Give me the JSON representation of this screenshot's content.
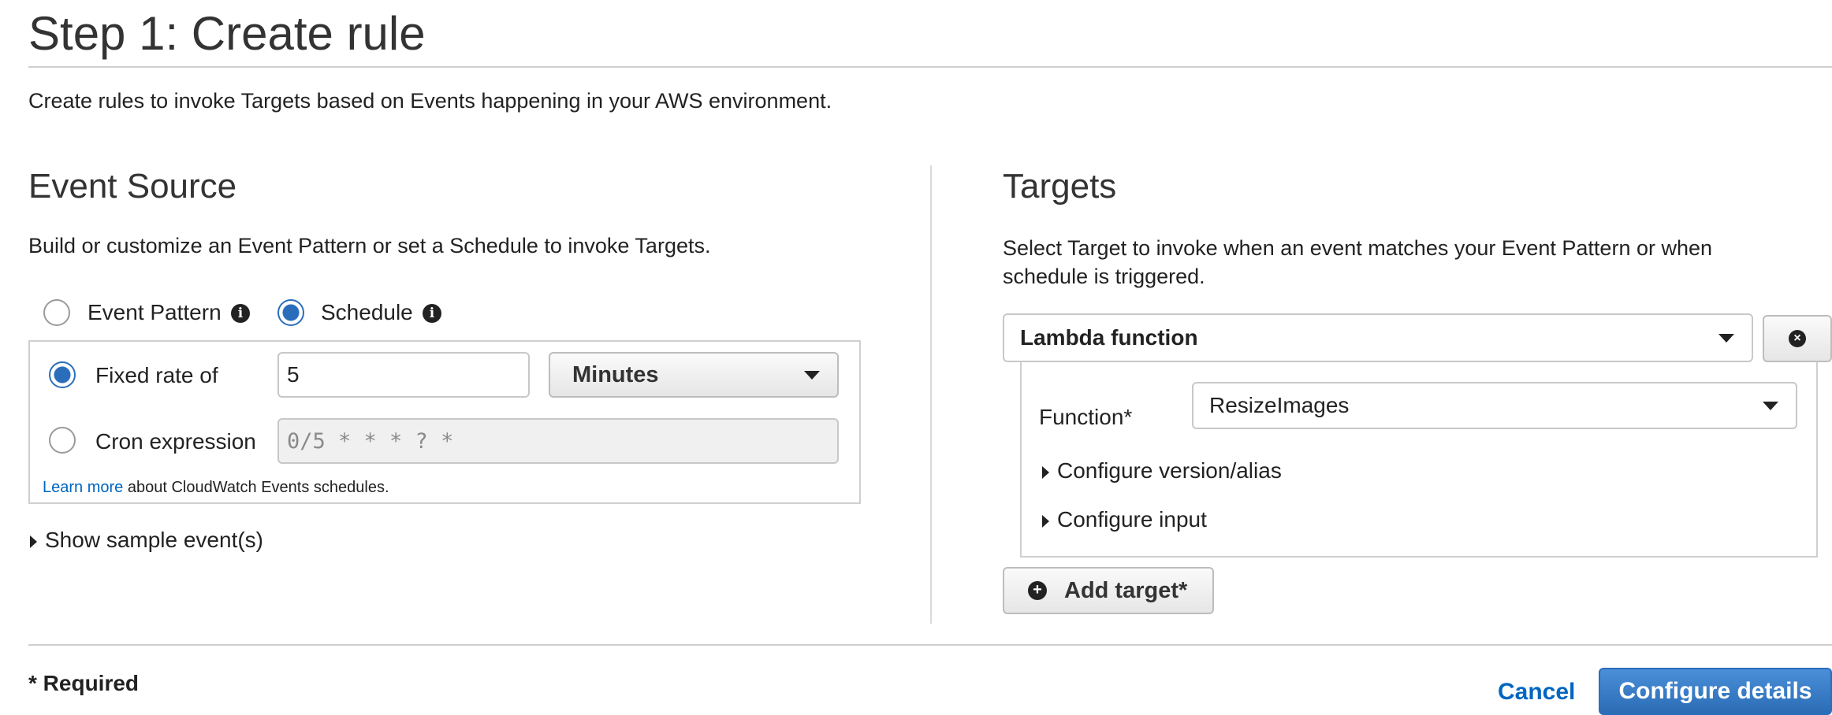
{
  "page": {
    "title": "Step 1: Create rule",
    "description": "Create rules to invoke Targets based on Events happening in your AWS environment."
  },
  "event_source": {
    "heading": "Event Source",
    "description": "Build or customize an Event Pattern or set a Schedule to invoke Targets.",
    "mode_options": [
      {
        "label": "Event Pattern",
        "selected": false
      },
      {
        "label": "Schedule",
        "selected": true
      }
    ],
    "info_glyph": "i",
    "schedule": {
      "fixed_rate": {
        "label": "Fixed rate of",
        "selected": true,
        "value": "5",
        "unit": "Minutes"
      },
      "cron": {
        "label": "Cron expression",
        "selected": false,
        "placeholder": "0/5 * * * ? *"
      },
      "learn_more_link": "Learn more",
      "learn_more_text": " about CloudWatch Events schedules."
    },
    "show_sample": "Show sample event(s)"
  },
  "targets": {
    "heading": "Targets",
    "description": "Select Target to invoke when an event matches your Event Pattern or when schedule is triggered.",
    "target_type": "Lambda function",
    "function_label": "Function*",
    "function_value": "ResizeImages",
    "configure_version": "Configure version/alias",
    "configure_input": "Configure input",
    "add_target": "Add target*",
    "remove_glyph": "×",
    "add_glyph": "+"
  },
  "footer": {
    "required_note": "* Required",
    "cancel": "Cancel",
    "configure_details": "Configure details"
  },
  "colors": {
    "accent": "#2a6ebb",
    "link": "#0066c0"
  },
  "icons": [
    "info-icon",
    "chevron-down-icon",
    "caret-right-icon",
    "close-circle-icon",
    "plus-circle-icon"
  ]
}
